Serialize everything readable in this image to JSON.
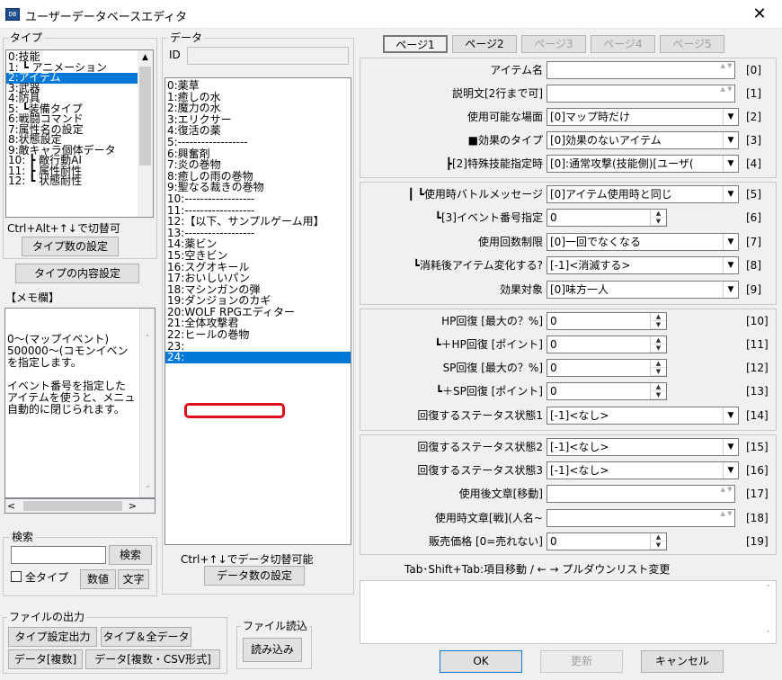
{
  "window": {
    "title": "ユーザーデータベースエディタ",
    "icon": "app-icon",
    "close": "✕"
  },
  "type_group": {
    "label": "タイプ",
    "items": [
      "0:技能",
      "1: ┗ アニメーション",
      "2:アイテム",
      "3:武器",
      "4:防具",
      "5: ┗装備タイプ",
      "6:戦闘コマンド",
      "7:属性名の設定",
      "8:状態設定",
      "9:敵キャラ個体データ",
      "10: ┣ 敵行動AI",
      "11: ┣ 属性耐性",
      "12: ┗ 状態耐性"
    ],
    "selected_index": 2,
    "hint": "Ctrl+Alt+↑↓で切替可",
    "count_button": "タイプ数の設定",
    "content_button": "タイプの内容設定"
  },
  "memo": {
    "label": "【メモ欄】",
    "lines": [
      "0～(マップイベント)",
      "500000～(コモンイベン",
      "を指定します。",
      "",
      "イベント番号を指定した",
      "アイテムを使うと、メニュ",
      "自動的に閉じられます。"
    ]
  },
  "search": {
    "label": "検索",
    "button": "検索",
    "all_types": "全タイプ",
    "num_button": "数値",
    "text_button": "文字"
  },
  "file_output": {
    "label": "ファイルの出力",
    "buttons": [
      "タイプ設定出力",
      "タイプ＆全データ",
      "データ[複数]",
      "データ[複数・CSV形式]"
    ]
  },
  "file_read": {
    "label": "ファイル読込",
    "button": "読み込み"
  },
  "data_group": {
    "label": "データ",
    "id_label": "ID",
    "items": [
      "0:薬草",
      "1:癒しの水",
      "2:魔力の水",
      "3:エリクサー",
      "4:復活の薬",
      "5:------------------",
      "6:興奮剤",
      "7:炎の巻物",
      "8:癒しの雨の巻物",
      "9:聖なる裁きの巻物",
      "10:------------------",
      "11:------------------",
      "12:【以下、サンプルゲーム用】",
      "13:------------------",
      "14:薬ビン",
      "15:空きビン",
      "16:スグオキール",
      "17:おいしいパン",
      "18:マシンガンの弾",
      "19:ダンジョンのカギ",
      "20:WOLF RPGエディター",
      "21:全体攻撃君",
      "22:ヒールの巻物",
      "23:",
      "24:"
    ],
    "selected_index": 24,
    "hint": "Ctrl+↑↓でデータ切替可能",
    "count_button": "データ数の設定"
  },
  "tabs": [
    {
      "label": "ページ1",
      "state": "active"
    },
    {
      "label": "ページ2",
      "state": "normal"
    },
    {
      "label": "ページ3",
      "state": "disabled"
    },
    {
      "label": "ページ4",
      "state": "disabled"
    },
    {
      "label": "ページ5",
      "state": "disabled"
    }
  ],
  "fields": [
    {
      "label": "アイテム名",
      "kind": "text",
      "value": "",
      "index": "[0]"
    },
    {
      "label": "説明文[2行まで可]",
      "kind": "text",
      "value": "",
      "index": "[1]"
    },
    {
      "label": "使用可能な場面",
      "kind": "combo",
      "value": "[0]マップ時だけ",
      "index": "[2]"
    },
    {
      "label": "■効果のタイプ",
      "kind": "combo",
      "value": "[0]効果のないアイテム",
      "index": "[3]"
    },
    {
      "label": "┣[2]特殊技能指定時",
      "kind": "combo",
      "value": "[0]:通常攻撃(技能側)[ユーザ(",
      "index": "[4]"
    },
    {
      "label": "┃ ┗使用時バトルメッセージ",
      "kind": "combo",
      "value": "[0]アイテム使用時と同じ",
      "index": "[5]"
    },
    {
      "label": "┗[3]イベント番号指定",
      "kind": "spin",
      "value": "0",
      "index": "[6]"
    },
    {
      "label": "使用回数制限",
      "kind": "combo",
      "value": "[0]一回でなくなる",
      "index": "[7]"
    },
    {
      "label": "┗消耗後アイテム変化する?",
      "kind": "combo",
      "value": "[-1]<消滅する>",
      "index": "[8]"
    },
    {
      "label": "効果対象",
      "kind": "combo",
      "value": "[0]味方一人",
      "index": "[9]"
    },
    {
      "label": "HP回復 [最大の？%]",
      "kind": "spin",
      "value": "0",
      "index": "[10]"
    },
    {
      "label": "┗＋HP回復 [ポイント]",
      "kind": "spin",
      "value": "0",
      "index": "[11]"
    },
    {
      "label": "SP回復 [最大の？%]",
      "kind": "spin",
      "value": "0",
      "index": "[12]"
    },
    {
      "label": "┗＋SP回復 [ポイント]",
      "kind": "spin",
      "value": "0",
      "index": "[13]"
    },
    {
      "label": "回復するステータス状態1",
      "kind": "combo",
      "value": "[-1]<なし>",
      "index": "[14]"
    },
    {
      "label": "回復するステータス状態2",
      "kind": "combo",
      "value": "[-1]<なし>",
      "index": "[15]"
    },
    {
      "label": "回復するステータス状態3",
      "kind": "combo",
      "value": "[-1]<なし>",
      "index": "[16]"
    },
    {
      "label": "使用後文章[移動]",
      "kind": "text",
      "value": "",
      "index": "[17]"
    },
    {
      "label": "使用時文章[戦](人名~",
      "kind": "text",
      "value": "",
      "index": "[18]"
    },
    {
      "label": "販売価格 [0=売れない]",
      "kind": "spin",
      "value": "0",
      "index": "[19]"
    }
  ],
  "help_text": "Tab･Shift+Tab:項目移動 / ← → プルダウンリスト変更",
  "footer": {
    "ok": "OK",
    "update": "更新",
    "cancel": "キャンセル"
  },
  "colors": {
    "selection": "#0078d7",
    "highlight_ring": "#e0101a"
  }
}
